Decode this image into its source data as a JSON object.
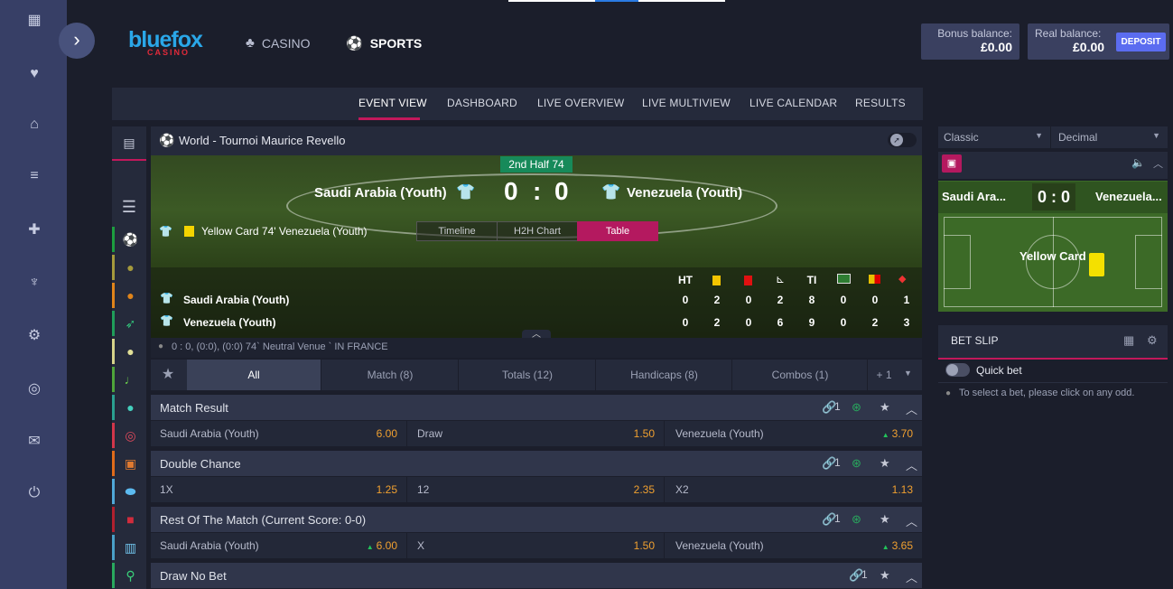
{
  "header": {
    "logo_main": "bluefox",
    "logo_sub": "CASINO",
    "nav_casino": "CASINO",
    "nav_sports": "SPORTS",
    "bonus_label": "Bonus balance:",
    "bonus_value": "£0.00",
    "real_label": "Real balance:",
    "real_value": "£0.00",
    "deposit": "DEPOSIT"
  },
  "subnav": {
    "items": [
      "EVENT VIEW",
      "DASHBOARD",
      "LIVE OVERVIEW",
      "LIVE MULTIVIEW",
      "LIVE CALENDAR",
      "RESULTS"
    ]
  },
  "event": {
    "title": "World - Tournoi Maurice Revello",
    "period": "2nd Half 74",
    "home": "Saudi Arabia (Youth)",
    "away": "Venezuela (Youth)",
    "score_home": "0",
    "score_sep": ":",
    "score_away": "0",
    "last_event": "Yellow Card 74' Venezuela (Youth)",
    "tabs": [
      "Timeline",
      "H2H Chart",
      "Table"
    ],
    "stat_headers": [
      "HT",
      "",
      "",
      "",
      "TI",
      "",
      "",
      ""
    ],
    "stats_home": [
      "0",
      "2",
      "0",
      "2",
      "8",
      "0",
      "0",
      "1"
    ],
    "stats_away": [
      "0",
      "2",
      "0",
      "6",
      "9",
      "0",
      "2",
      "3"
    ],
    "info": "0 : 0, (0:0), (0:0) 74` Neutral Venue ` IN FRANCE"
  },
  "market_tabs": [
    "All",
    "Match (8)",
    "Totals (12)",
    "Handicaps (8)",
    "Combos (1)",
    "+ 1"
  ],
  "markets": [
    {
      "title": "Match Result",
      "links": "1",
      "cells": [
        {
          "label": "Saudi Arabia (Youth)",
          "odd": "6.00",
          "up": false
        },
        {
          "label": "Draw",
          "odd": "1.50",
          "up": false
        },
        {
          "label": "Venezuela (Youth)",
          "odd": "3.70",
          "up": true
        }
      ]
    },
    {
      "title": "Double Chance",
      "links": "1",
      "cells": [
        {
          "label": "1X",
          "odd": "1.25",
          "up": false
        },
        {
          "label": "12",
          "odd": "2.35",
          "up": false
        },
        {
          "label": "X2",
          "odd": "1.13",
          "up": false
        }
      ]
    },
    {
      "title": "Rest Of The Match (Current Score: 0-0)",
      "links": "1",
      "cells": [
        {
          "label": "Saudi Arabia (Youth)",
          "odd": "6.00",
          "up": true
        },
        {
          "label": "X",
          "odd": "1.50",
          "up": false
        },
        {
          "label": "Venezuela (Youth)",
          "odd": "3.65",
          "up": true
        }
      ]
    },
    {
      "title": "Draw No Bet",
      "links": "1"
    }
  ],
  "right": {
    "format": "Classic",
    "odds_format": "Decimal",
    "mini_home": "Saudi Ara...",
    "mini_score": "0 : 0",
    "mini_away": "Venezuela...",
    "mini_event": "Yellow Card",
    "betslip_title": "BET SLIP",
    "quickbet": "Quick bet",
    "hint": "To select a bet, please click on any odd."
  },
  "colors": {
    "accent": "#c2185b",
    "odd": "#f0a030",
    "up": "#21c45a",
    "deposit": "#5b6cf0"
  }
}
